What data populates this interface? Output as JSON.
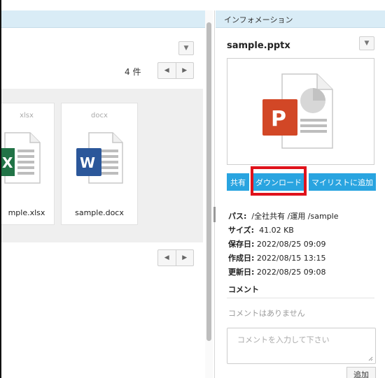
{
  "info_panel": {
    "header": "インフォメーション",
    "file_name": "sample.pptx",
    "buttons": {
      "share": "共有",
      "download": "ダウンロード",
      "add_mylist": "マイリストに追加"
    },
    "meta": {
      "path_label": "パス:",
      "path_value": "/全社共有 /運用 /sample",
      "size_label": "サイズ:",
      "size_value": "41.02 KB",
      "saved_label": "保存日:",
      "saved_value": "2022/08/25 09:09",
      "created_label": "作成日:",
      "created_value": "2022/08/15 13:15",
      "updated_label": "更新日:",
      "updated_value": "2022/08/25 09:08"
    },
    "comments": {
      "title": "コメント",
      "empty_text": "コメントはありません",
      "placeholder": "コメントを入力して下さい",
      "add_label": "追加"
    }
  },
  "file_list": {
    "count_text": "4 件",
    "files": [
      {
        "ext": "xlsx",
        "name": "mple.xlsx"
      },
      {
        "ext": "docx",
        "name": "sample.docx"
      }
    ]
  },
  "colors": {
    "header_bg": "#d9ecf6",
    "button_blue": "#29a4e0",
    "highlight_red": "#e0121b",
    "word_blue": "#2b579a",
    "excel_green": "#217346",
    "ppt_red": "#d24726"
  },
  "icons": [
    "chevron-down-icon",
    "arrow-left-icon",
    "arrow-right-icon",
    "powerpoint-file-icon",
    "word-file-icon",
    "excel-file-icon"
  ]
}
